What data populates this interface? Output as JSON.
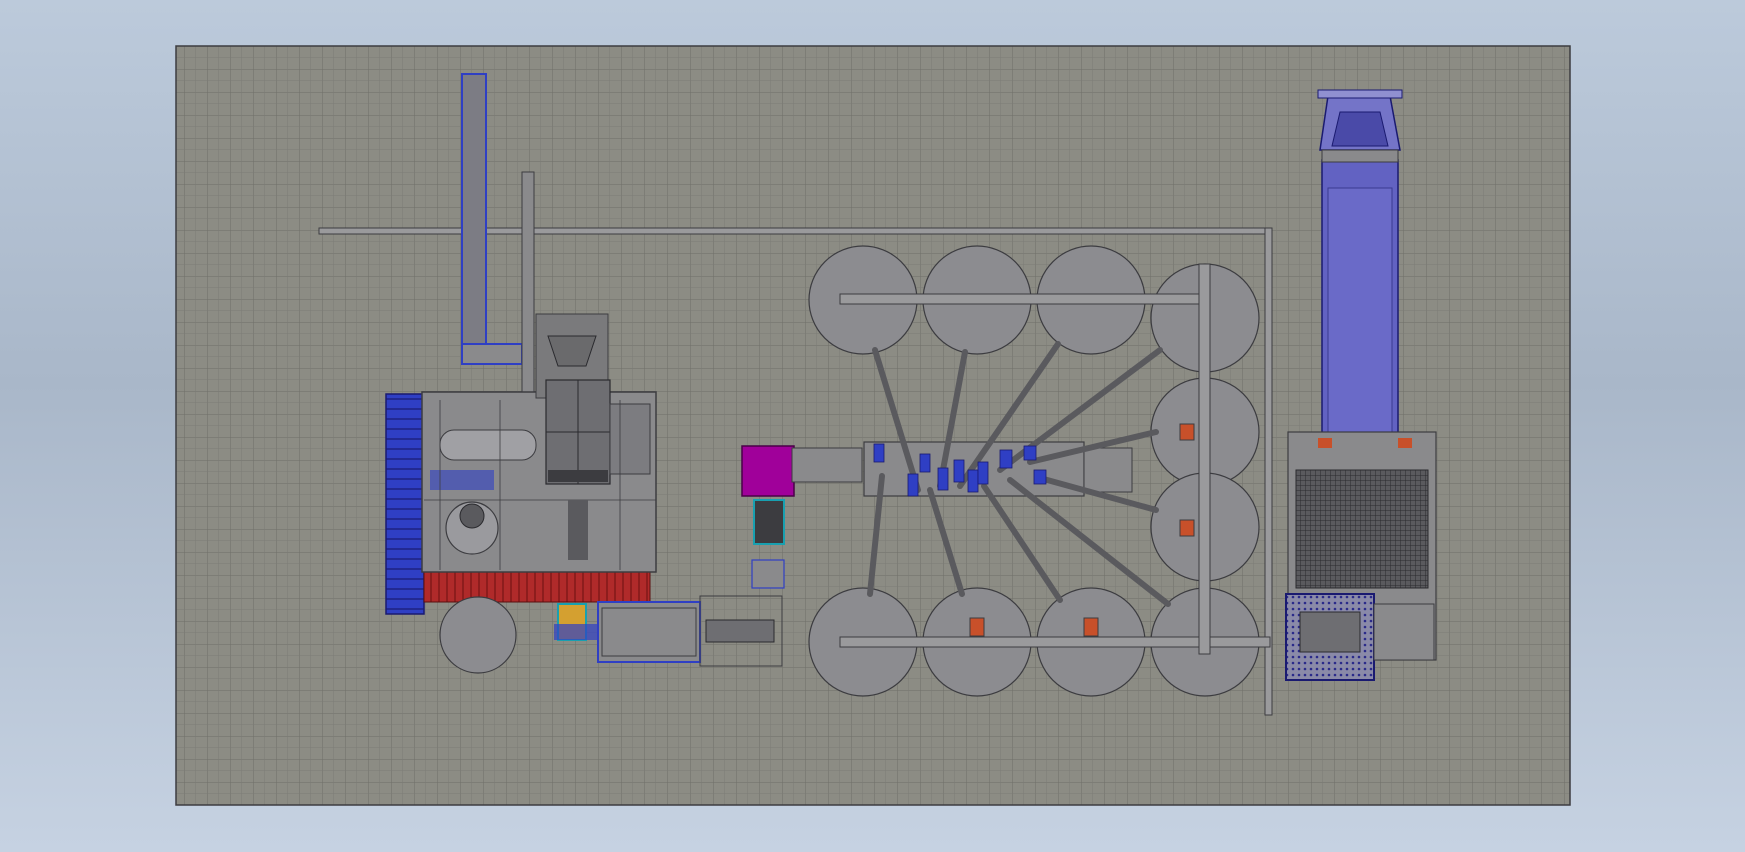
{
  "view": {
    "background": "#b4c2d4",
    "floor_color": "#8c8c84",
    "grid_color": "#6e6e68",
    "equipment_gray": "#8a8a8c",
    "outline_color": "#3c3c40"
  },
  "accents": {
    "blue_conveyor": "#2f3fc4",
    "red_hopper": "#b02a2a",
    "magenta_unit": "#a0009a",
    "truck_trailer": "#6262c2",
    "orange_valve": "#c8502a",
    "cyan_frame": "#18a0b0"
  },
  "silos": {
    "top_row_count": 4,
    "right_column_count": 2,
    "bottom_row_count": 4,
    "feed_screws": 8
  },
  "equipment": {
    "left_hopper_icon": "conveyor-stack-icon",
    "main_plant_icon": "mixing-plant-icon",
    "truck_icon": "truck-icon",
    "silo_icon": "silo-icon"
  }
}
